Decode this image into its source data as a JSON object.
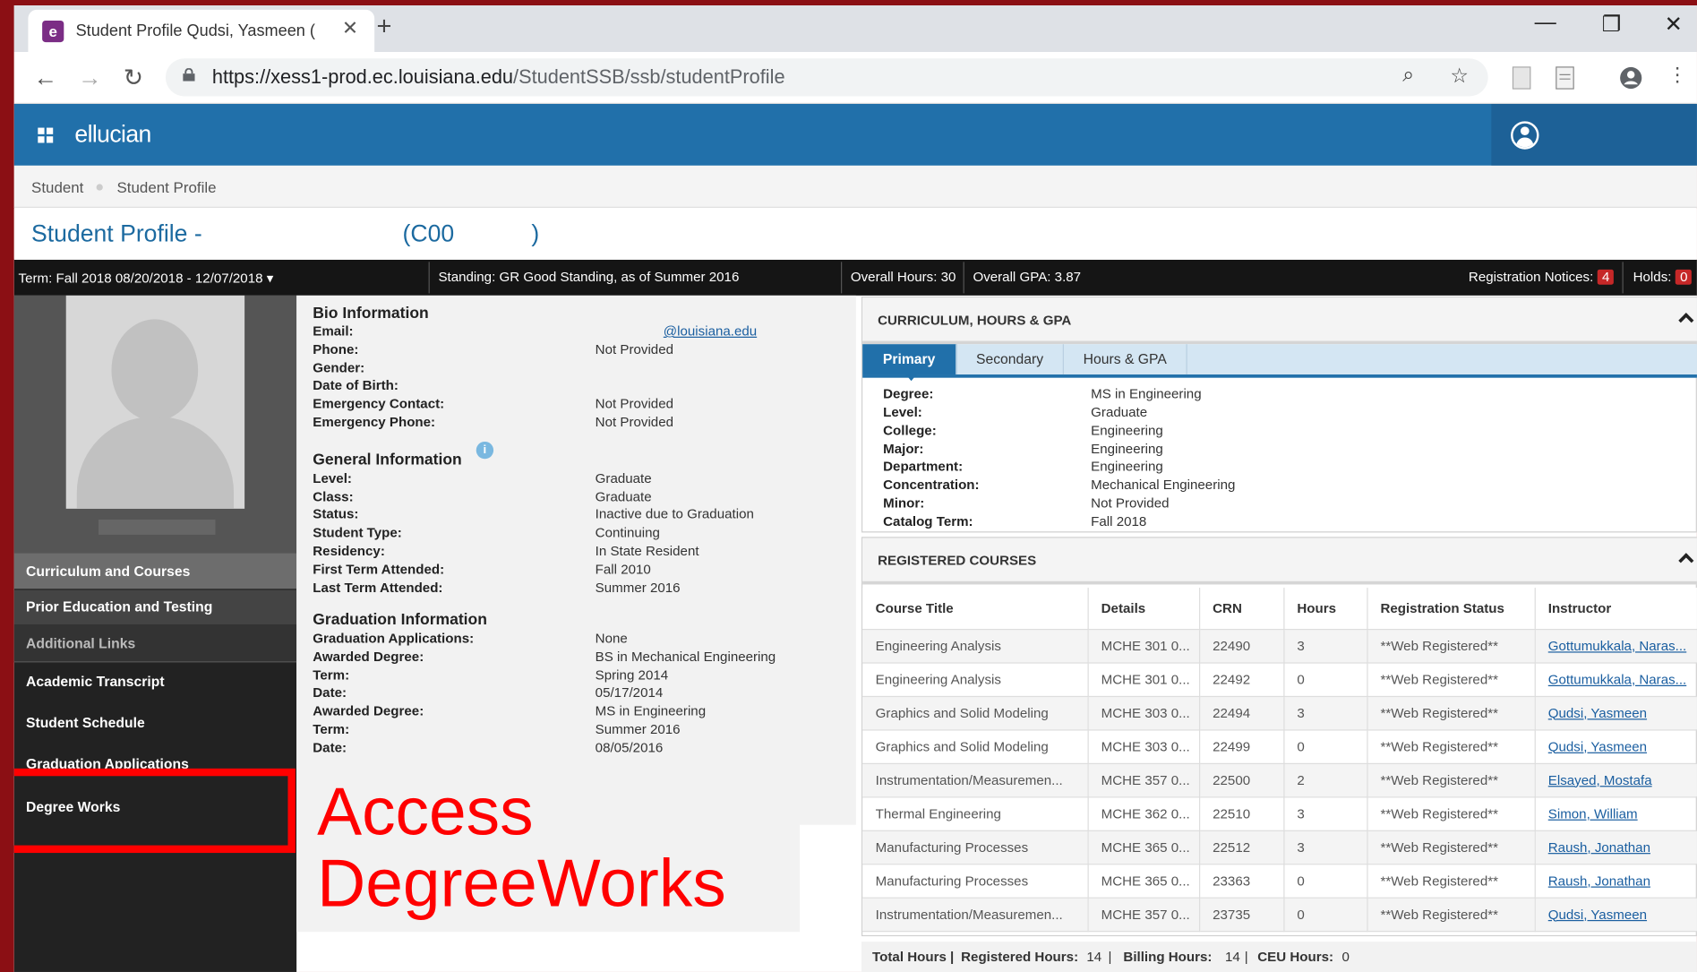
{
  "browser": {
    "tab_title": "Student Profile Qudsi, Yasmeen (",
    "url_host": "https://xess1-prod.ec.louisiana.edu",
    "url_path": "/StudentSSB/ssb/studentProfile"
  },
  "header": {
    "brand": "ellucian"
  },
  "breadcrumb": {
    "root": "Student",
    "current": "Student Profile"
  },
  "page_title": {
    "left": "Student Profile -",
    "right": "(C00",
    "close": ")"
  },
  "infobar": {
    "term_label": "Term:",
    "term_value": "Fall 2018 08/20/2018 - 12/07/2018",
    "standing_label": "Standing:",
    "standing_value": "GR Good Standing, as of Summer 2016",
    "hours_label": "Overall Hours:",
    "hours_value": "30",
    "gpa_label": "Overall GPA:",
    "gpa_value": "3.87",
    "notices_label": "Registration Notices:",
    "notices_count": "4",
    "holds_label": "Holds:",
    "holds_count": "0"
  },
  "sidebar": {
    "curriculum": "Curriculum and Courses",
    "prior": "Prior Education and Testing",
    "additional": "Additional Links",
    "links": [
      "Academic Transcript",
      "Student Schedule",
      "Graduation Applications",
      "Degree Works"
    ]
  },
  "bio": {
    "heading": "Bio Information",
    "rows": [
      {
        "label": "Email:",
        "value": "@louisiana.edu"
      },
      {
        "label": "Phone:",
        "value": "Not Provided"
      },
      {
        "label": "Gender:",
        "value": ""
      },
      {
        "label": "Date of Birth:",
        "value": ""
      },
      {
        "label": "Emergency Contact:",
        "value": "Not Provided"
      },
      {
        "label": "Emergency Phone:",
        "value": "Not Provided"
      }
    ]
  },
  "general": {
    "heading": "General Information",
    "info_icon_glyph": "i",
    "rows": [
      {
        "label": "Level:",
        "value": "Graduate"
      },
      {
        "label": "Class:",
        "value": "Graduate"
      },
      {
        "label": "Status:",
        "value": "Inactive due to Graduation"
      },
      {
        "label": "Student Type:",
        "value": "Continuing"
      },
      {
        "label": "Residency:",
        "value": "In State Resident"
      },
      {
        "label": "First Term Attended:",
        "value": "Fall 2010"
      },
      {
        "label": "Last Term Attended:",
        "value": "Summer 2016"
      }
    ]
  },
  "graduation": {
    "heading": "Graduation Information",
    "rows": [
      {
        "label": "Graduation Applications:",
        "value": "None"
      },
      {
        "label": "Awarded Degree:",
        "value": "BS in Mechanical Engineering"
      },
      {
        "label": "Term:",
        "value": "Spring 2014"
      },
      {
        "label": "Date:",
        "value": "05/17/2014"
      },
      {
        "label": "Awarded Degree:",
        "value": "MS in Engineering"
      },
      {
        "label": "Term:",
        "value": "Summer 2016"
      },
      {
        "label": "Date:",
        "value": "08/05/2016"
      }
    ]
  },
  "annotation": {
    "line1": "Access",
    "line2": "DegreeWorks",
    "color": "#ff0000"
  },
  "curriculum": {
    "heading": "CURRICULUM, HOURS & GPA",
    "tabs": [
      "Primary",
      "Secondary",
      "Hours & GPA"
    ],
    "rows": [
      {
        "label": "Degree:",
        "value": "MS in Engineering"
      },
      {
        "label": "Level:",
        "value": "Graduate"
      },
      {
        "label": "College:",
        "value": "Engineering"
      },
      {
        "label": "Major:",
        "value": "Engineering"
      },
      {
        "label": "Department:",
        "value": "Engineering"
      },
      {
        "label": "Concentration:",
        "value": "Mechanical Engineering"
      },
      {
        "label": "Minor:",
        "value": "Not Provided"
      },
      {
        "label": "Catalog Term:",
        "value": "Fall 2018"
      }
    ]
  },
  "registered": {
    "heading": "REGISTERED COURSES",
    "columns": [
      "Course Title",
      "Details",
      "CRN",
      "Hours",
      "Registration Status",
      "Instructor"
    ],
    "rows": [
      [
        "Engineering Analysis",
        "MCHE 301 0...",
        "22490",
        "3",
        "**Web Registered**",
        "Gottumukkala, Naras..."
      ],
      [
        "Engineering Analysis",
        "MCHE 301 0...",
        "22492",
        "0",
        "**Web Registered**",
        "Gottumukkala, Naras..."
      ],
      [
        "Graphics and Solid Modeling",
        "MCHE 303 0...",
        "22494",
        "3",
        "**Web Registered**",
        "Qudsi, Yasmeen"
      ],
      [
        "Graphics and Solid Modeling",
        "MCHE 303 0...",
        "22499",
        "0",
        "**Web Registered**",
        "Qudsi, Yasmeen"
      ],
      [
        "Instrumentation/Measuremen...",
        "MCHE 357 0...",
        "22500",
        "2",
        "**Web Registered**",
        "Elsayed, Mostafa"
      ],
      [
        "Thermal Engineering",
        "MCHE 362 0...",
        "22510",
        "3",
        "**Web Registered**",
        "Simon, William"
      ],
      [
        "Manufacturing Processes",
        "MCHE 365 0...",
        "22512",
        "3",
        "**Web Registered**",
        "Raush, Jonathan"
      ],
      [
        "Manufacturing Processes",
        "MCHE 365 0...",
        "23363",
        "0",
        "**Web Registered**",
        "Raush, Jonathan"
      ],
      [
        "Instrumentation/Measuremen...",
        "MCHE 357 0...",
        "23735",
        "0",
        "**Web Registered**",
        "Qudsi, Yasmeen"
      ]
    ],
    "totals": {
      "total_label": "Total Hours |",
      "registered_label": "Registered Hours:",
      "registered_value": "14",
      "sep1": "|",
      "billing_label": "Billing Hours:",
      "billing_value": "14",
      "sep2": "|",
      "ceu_label": "CEU Hours:",
      "ceu_value": "0"
    }
  },
  "colors": {
    "brand_blue": "#2170aa",
    "frame_red": "#8b0f14",
    "badge_red": "#c62828"
  },
  "icons": [
    "back-icon",
    "forward-icon",
    "reload-icon",
    "lock-icon",
    "zoom-icon",
    "star-icon",
    "user-icon",
    "apps-grid-icon",
    "info-icon"
  ]
}
